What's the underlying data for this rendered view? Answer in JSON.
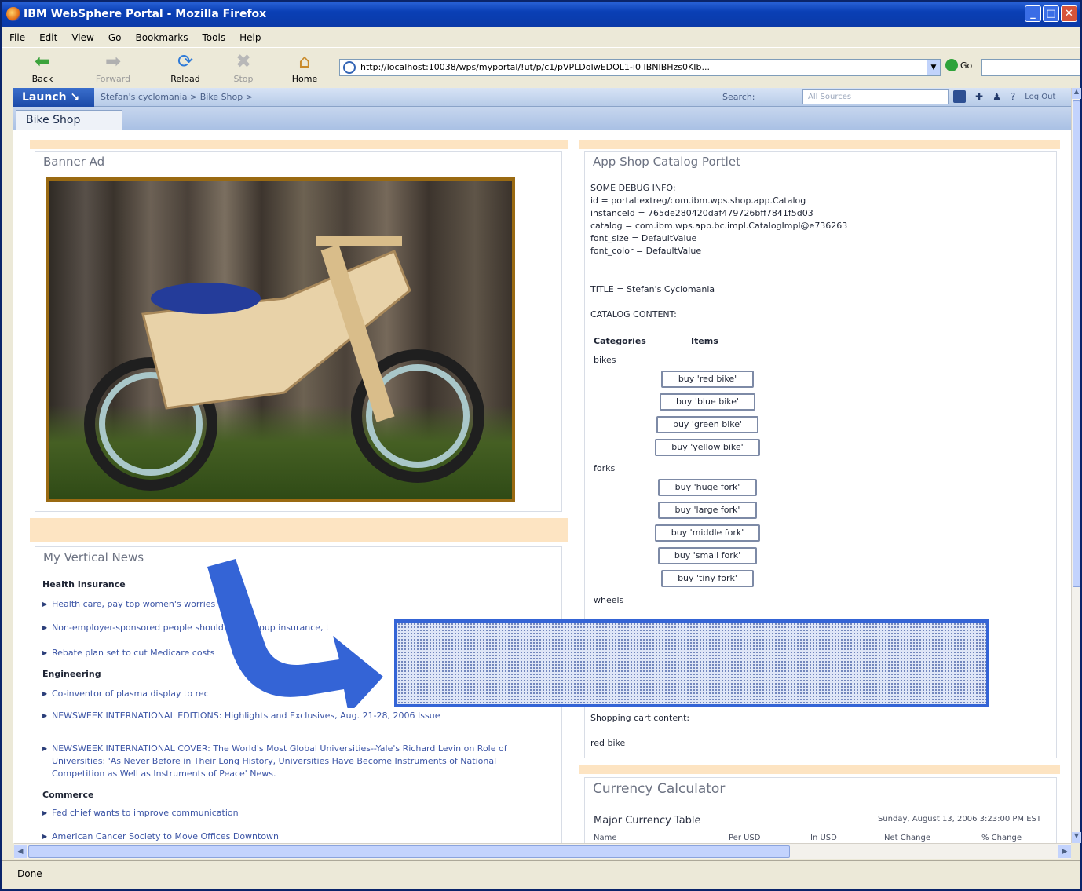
{
  "window": {
    "title": "IBM WebSphere Portal - Mozilla Firefox"
  },
  "menu": [
    "File",
    "Edit",
    "View",
    "Go",
    "Bookmarks",
    "Tools",
    "Help"
  ],
  "toolbar": {
    "back": "Back",
    "forward": "Forward",
    "reload": "Reload",
    "stop": "Stop",
    "home": "Home",
    "go": "Go"
  },
  "address": {
    "url": "http://localhost:10038/wps/myportal/!ut/p/c1/pVPLDoIwEDOL1-i0 IBNIBHzs0KIb..."
  },
  "portal": {
    "launch": "Launch",
    "breadcrumb": "Stefan's cyclomania > Bike Shop >",
    "search_label": "Search:",
    "search_placeholder": "All Sources",
    "logout": "Log Out",
    "tab": "Bike Shop"
  },
  "banner": {
    "title": "Banner Ad"
  },
  "catalog": {
    "title": "App Shop Catalog Portlet",
    "debug": [
      "SOME DEBUG INFO:",
      "id = portal:extreg/com.ibm.wps.shop.app.Catalog",
      "instanceId = 765de280420daf479726bff7841f5d03",
      "catalog = com.ibm.wps.app.bc.impl.CatalogImpl@e736263",
      "font_size = DefaultValue",
      "font_color = DefaultValue"
    ],
    "title_line": "TITLE = Stefan's Cyclomania",
    "content_label": "CATALOG CONTENT:",
    "col_categories": "Categories",
    "col_items": "Items",
    "cat_bikes": "bikes",
    "cat_forks": "forks",
    "cat_wheels": "wheels",
    "bikes": [
      "buy 'red bike'",
      "buy 'blue bike'",
      "buy 'green bike'",
      "buy 'yellow bike'"
    ],
    "forks": [
      "buy 'huge fork'",
      "buy 'large fork'",
      "buy 'middle fork'",
      "buy 'small fork'",
      "buy 'tiny fork'"
    ],
    "cart_label": "Shopping cart content:",
    "cart_item": "red bike"
  },
  "news": {
    "title": "My Vertical News",
    "sections": [
      {
        "heading": "Health Insurance",
        "items": [
          "Health care, pay top women's worries",
          "Non-employer-sponsored people should have group insurance, t",
          "Rebate plan set to cut Medicare costs"
        ]
      },
      {
        "heading": "Engineering",
        "items": [
          "Co-inventor of plasma display to rec",
          "NEWSWEEK INTERNATIONAL EDITIONS: Highlights and Exclusives, Aug. 21-28, 2006 Issue",
          "NEWSWEEK INTERNATIONAL COVER: The World's Most Global Universities--Yale's Richard Levin on Role of Universities: 'As Never Before in Their Long History, Universities Have Become Instruments of National Competition as Well as Instruments of Peace' News."
        ]
      },
      {
        "heading": "Commerce",
        "items": [
          "Fed chief wants to improve communication",
          "American Cancer Society to Move Offices Downtown"
        ]
      }
    ]
  },
  "currency": {
    "title": "Currency Calculator",
    "table_title": "Major Currency Table",
    "date": "Sunday, August 13, 2006 3:23:00 PM EST",
    "cols": [
      "Name",
      "Per USD",
      "In USD",
      "Net Change",
      "% Change"
    ]
  },
  "status": {
    "text": "Done"
  },
  "colors": {
    "accent": "#3464d6",
    "orange": "#fde4c2",
    "title_blue": "#0a3fb5"
  }
}
